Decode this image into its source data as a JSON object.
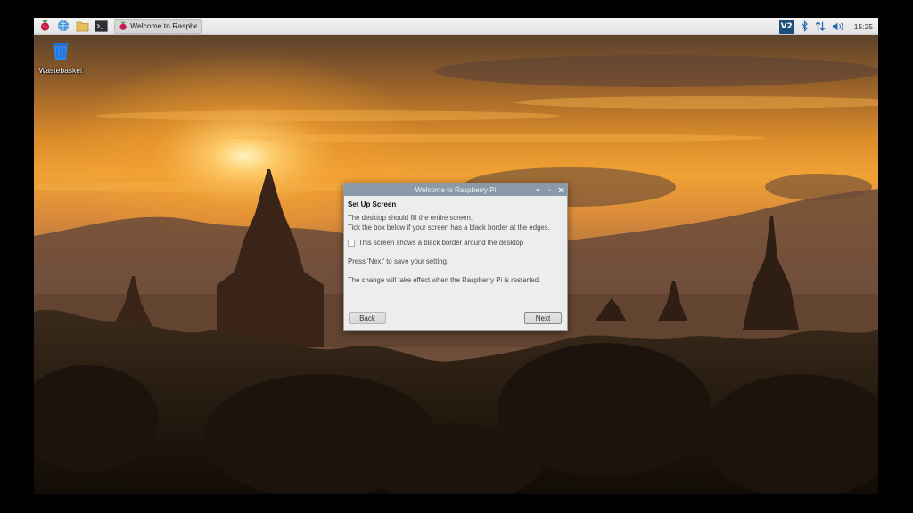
{
  "taskbar": {
    "launchers": [
      "raspberry-menu-icon",
      "web-browser-icon",
      "file-manager-icon",
      "terminal-icon"
    ],
    "task_label": "Welcome to Raspberr...",
    "tray": {
      "vnc_label": "V2",
      "clock": "15:25"
    }
  },
  "desktop": {
    "icons": [
      {
        "label": "Wastebasket",
        "icon": "wastebasket-icon"
      }
    ]
  },
  "dialog": {
    "title": "Welcome to Raspberry Pi",
    "heading": "Set Up Screen",
    "line1": "The desktop should fill the entire screen.",
    "line2": "Tick the box below if your screen has a black border at the edges.",
    "checkbox_label": "This screen shows a black border around the desktop",
    "checkbox_checked": false,
    "line3": "Press 'Next' to save your setting.",
    "line4": "The change will take effect when the Raspberry Pi is restarted.",
    "back_label": "Back",
    "next_label": "Next"
  },
  "colors": {
    "taskbar": "#ececec",
    "dialog_titlebar": "#8a9aa8",
    "dialog_bg": "#ededed",
    "sky": "#e6922e"
  }
}
